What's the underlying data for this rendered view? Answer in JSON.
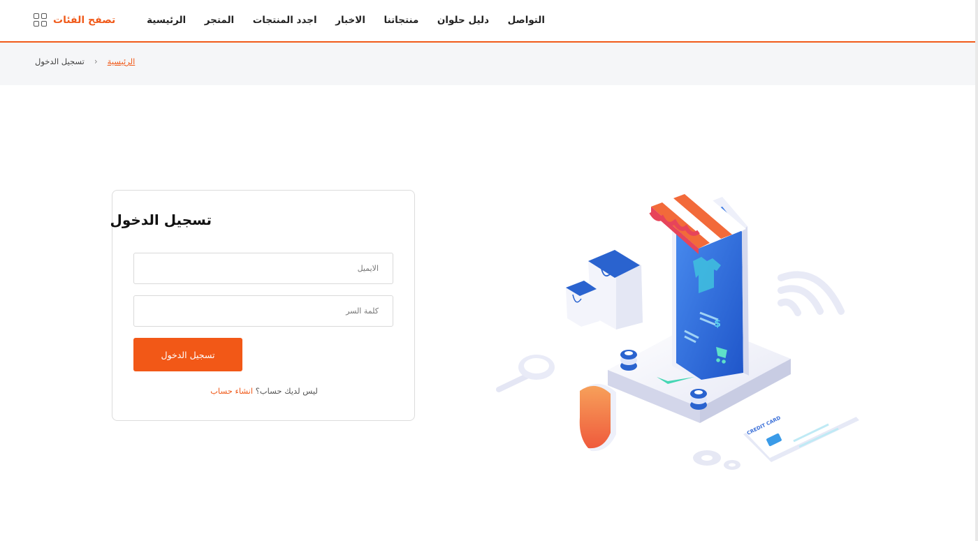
{
  "header": {
    "nav": [
      "الرئيسية",
      "المتجر",
      "اجدد المنتجات",
      "الاخبار",
      "منتجاتنا",
      "دليل حلوان",
      "التواصل"
    ],
    "browse_label": "تصفح الفئات",
    "browse_icon": "grid-icon",
    "accent_color": "#f05a1a"
  },
  "breadcrumb": {
    "home": "الرئيسية",
    "separator": "‹",
    "current": "تسجيل الدخول"
  },
  "login": {
    "title": "تسجيل الدخول",
    "email_placeholder": "الايميل",
    "email_value": "",
    "password_placeholder": "كلمة السر",
    "password_value": "",
    "submit_label": "تسجيل الدخول",
    "signup_prompt": "ليس لديك حساب؟",
    "signup_link": "انشاء حساب"
  },
  "illustration": {
    "card_text": "CREDIT CARD",
    "currency_symbol": "$"
  }
}
